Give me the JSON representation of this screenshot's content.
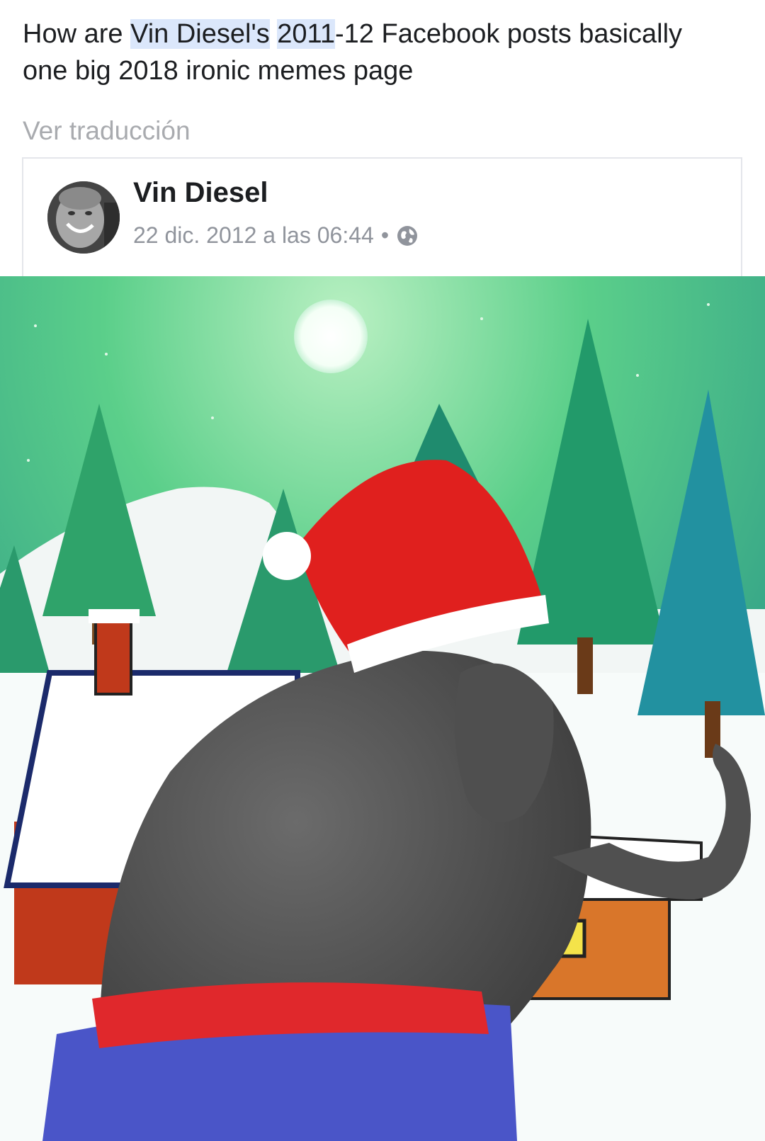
{
  "post": {
    "caption_parts": [
      "How are ",
      "Vin Diesel's",
      " ",
      "2011",
      "-12 Facebook posts basically one big 2018 ironic memes page"
    ],
    "translate_link": "Ver traducción"
  },
  "shared_post": {
    "author": "Vin Diesel",
    "timestamp": "22 dic. 2012 a las 06:44",
    "separator": "•",
    "privacy_icon": "globe-icon"
  },
  "colors": {
    "highlight": "#dbe7fb",
    "muted_text": "#a9abaf",
    "card_border": "#e4e6eb"
  }
}
